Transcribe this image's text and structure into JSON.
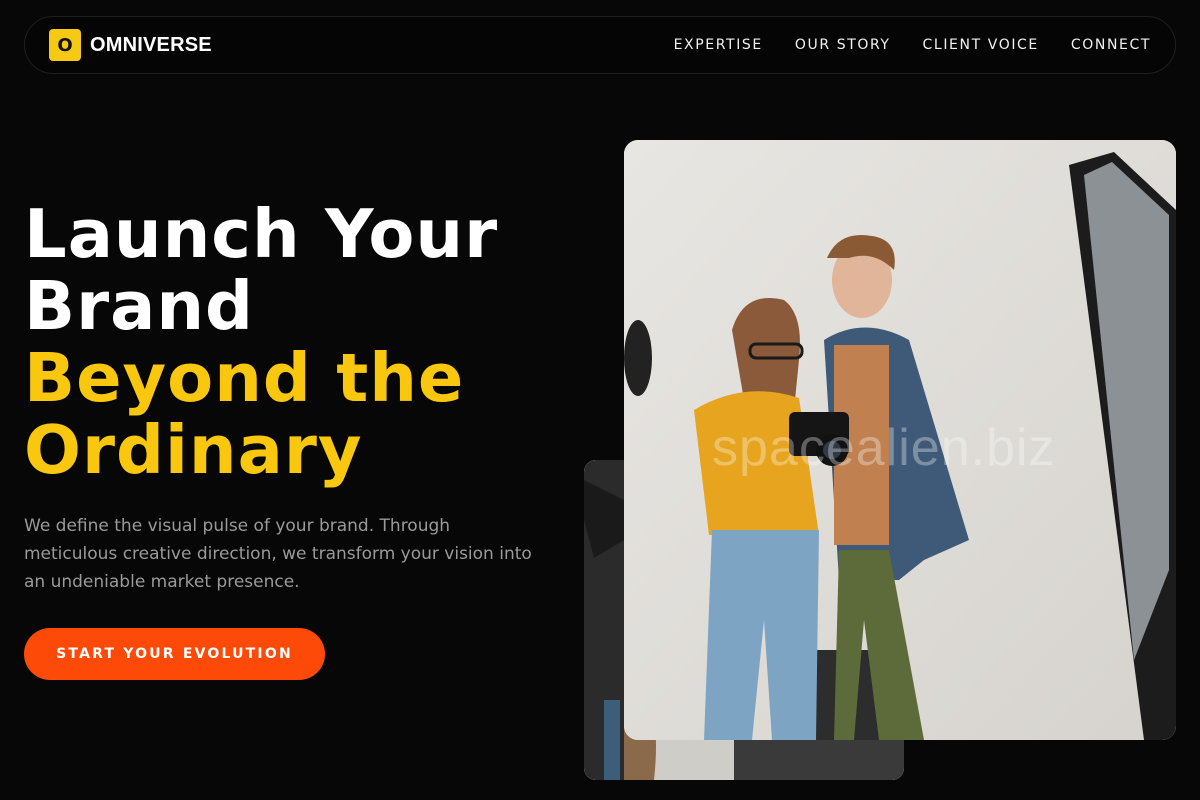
{
  "brand": {
    "logo_letter": "O",
    "name": "OMNIVERSE"
  },
  "nav": {
    "links": [
      {
        "label": "EXPERTISE"
      },
      {
        "label": "OUR STORY"
      },
      {
        "label": "CLIENT VOICE"
      },
      {
        "label": "CONNECT"
      }
    ]
  },
  "hero": {
    "title_line1": "Launch Your",
    "title_line2": "Brand",
    "title_accent_line1": "Beyond the",
    "title_accent_line2": "Ordinary",
    "description": "We define the visual pulse of your brand. Through meticulous creative direction, we transform your vision into an undeniable market presence.",
    "cta_label": "START YOUR EVOLUTION"
  },
  "media": {
    "watermark": "spacealien.biz"
  },
  "colors": {
    "background": "#070707",
    "accent_yellow": "#f9c80e",
    "cta_orange": "#fe4a08",
    "muted_text": "#9a9a9a"
  }
}
